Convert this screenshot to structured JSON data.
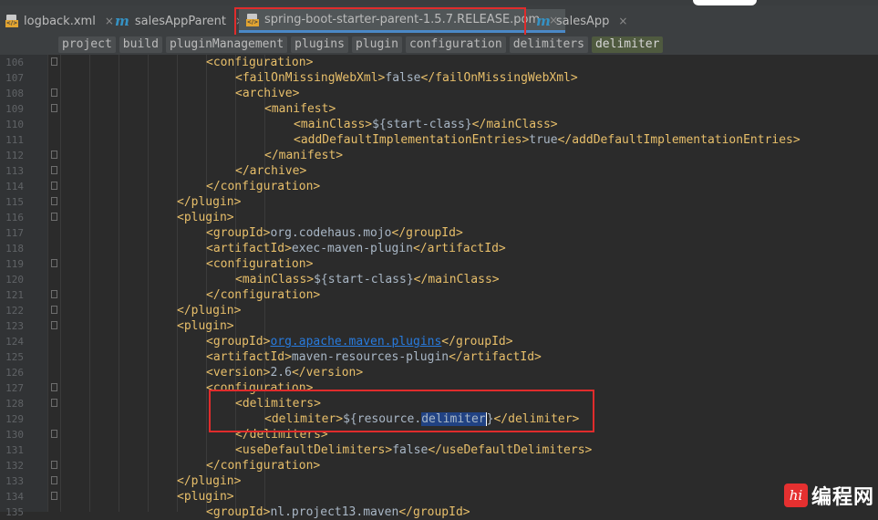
{
  "tabs": [
    {
      "label": "logback.xml",
      "icon": "xml-file-icon"
    },
    {
      "label": "salesAppParent",
      "icon": "maven-icon"
    },
    {
      "label": "spring-boot-starter-parent-1.5.7.RELEASE.pom",
      "icon": "xml-file-icon",
      "active": true
    },
    {
      "label": "salesApp",
      "icon": "maven-icon"
    }
  ],
  "close_glyph": "×",
  "breadcrumbs": [
    "project",
    "build",
    "pluginManagement",
    "plugins",
    "plugin",
    "configuration",
    "delimiters",
    "delimiter"
  ],
  "lines": [
    {
      "n": "106",
      "indent": 4,
      "parts": [
        [
          "tg",
          "<configuration>"
        ]
      ]
    },
    {
      "n": "107",
      "indent": 5,
      "parts": [
        [
          "tg",
          "<failOnMissingWebXml>"
        ],
        [
          "tx",
          "false"
        ],
        [
          "tg",
          "</failOnMissingWebXml>"
        ]
      ]
    },
    {
      "n": "108",
      "indent": 5,
      "parts": [
        [
          "tg",
          "<archive>"
        ]
      ]
    },
    {
      "n": "109",
      "indent": 6,
      "parts": [
        [
          "tg",
          "<manifest>"
        ]
      ]
    },
    {
      "n": "110",
      "indent": 7,
      "parts": [
        [
          "tg",
          "<mainClass>"
        ],
        [
          "tx",
          "${start-class}"
        ],
        [
          "tg",
          "</mainClass>"
        ]
      ]
    },
    {
      "n": "111",
      "indent": 7,
      "parts": [
        [
          "tg",
          "<addDefaultImplementationEntries>"
        ],
        [
          "tx",
          "true"
        ],
        [
          "tg",
          "</addDefaultImplementationEntries>"
        ]
      ]
    },
    {
      "n": "112",
      "indent": 6,
      "parts": [
        [
          "tg",
          "</manifest>"
        ]
      ]
    },
    {
      "n": "113",
      "indent": 5,
      "parts": [
        [
          "tg",
          "</archive>"
        ]
      ]
    },
    {
      "n": "114",
      "indent": 4,
      "parts": [
        [
          "tg",
          "</configuration>"
        ]
      ]
    },
    {
      "n": "115",
      "indent": 3,
      "parts": [
        [
          "tg",
          "</plugin>"
        ]
      ]
    },
    {
      "n": "116",
      "indent": 3,
      "parts": [
        [
          "tg",
          "<plugin>"
        ]
      ]
    },
    {
      "n": "117",
      "indent": 4,
      "parts": [
        [
          "tg",
          "<groupId>"
        ],
        [
          "tx",
          "org.codehaus.mojo"
        ],
        [
          "tg",
          "</groupId>"
        ]
      ]
    },
    {
      "n": "118",
      "indent": 4,
      "parts": [
        [
          "tg",
          "<artifactId>"
        ],
        [
          "tx",
          "exec-maven-plugin"
        ],
        [
          "tg",
          "</artifactId>"
        ]
      ]
    },
    {
      "n": "119",
      "indent": 4,
      "parts": [
        [
          "tg",
          "<configuration>"
        ]
      ]
    },
    {
      "n": "120",
      "indent": 5,
      "parts": [
        [
          "tg",
          "<mainClass>"
        ],
        [
          "tx",
          "${start-class}"
        ],
        [
          "tg",
          "</mainClass>"
        ]
      ]
    },
    {
      "n": "121",
      "indent": 4,
      "parts": [
        [
          "tg",
          "</configuration>"
        ]
      ]
    },
    {
      "n": "122",
      "indent": 3,
      "parts": [
        [
          "tg",
          "</plugin>"
        ]
      ]
    },
    {
      "n": "123",
      "indent": 3,
      "parts": [
        [
          "tg",
          "<plugin>"
        ]
      ]
    },
    {
      "n": "124",
      "indent": 4,
      "parts": [
        [
          "tg",
          "<groupId>"
        ],
        [
          "lnk",
          "org.apache.maven.plugins"
        ],
        [
          "tg",
          "</groupId>"
        ]
      ]
    },
    {
      "n": "125",
      "indent": 4,
      "parts": [
        [
          "tg",
          "<artifactId>"
        ],
        [
          "tx",
          "maven-resources-plugin"
        ],
        [
          "tg",
          "</artifactId>"
        ]
      ]
    },
    {
      "n": "126",
      "indent": 4,
      "parts": [
        [
          "tg",
          "<version>"
        ],
        [
          "tx",
          "2.6"
        ],
        [
          "tg",
          "</version>"
        ]
      ]
    },
    {
      "n": "127",
      "indent": 4,
      "parts": [
        [
          "tg",
          "<configuration>"
        ]
      ]
    },
    {
      "n": "128",
      "indent": 5,
      "parts": [
        [
          "tg",
          "<delimiters>"
        ]
      ]
    },
    {
      "n": "129",
      "indent": 6,
      "parts": [
        [
          "tg",
          "<delimiter>"
        ],
        [
          "tx",
          "${resource."
        ],
        [
          "selw",
          "delimiter"
        ],
        [
          "caret",
          ""
        ],
        [
          "tx",
          "}"
        ],
        [
          "tg",
          "</delimiter>"
        ]
      ]
    },
    {
      "n": "130",
      "indent": 5,
      "parts": [
        [
          "tg",
          "</delimiters>"
        ]
      ]
    },
    {
      "n": "131",
      "indent": 5,
      "parts": [
        [
          "tg",
          "<useDefaultDelimiters>"
        ],
        [
          "tx",
          "false"
        ],
        [
          "tg",
          "</useDefaultDelimiters>"
        ]
      ]
    },
    {
      "n": "132",
      "indent": 4,
      "parts": [
        [
          "tg",
          "</configuration>"
        ]
      ]
    },
    {
      "n": "133",
      "indent": 3,
      "parts": [
        [
          "tg",
          "</plugin>"
        ]
      ]
    },
    {
      "n": "134",
      "indent": 3,
      "parts": [
        [
          "tg",
          "<plugin>"
        ]
      ]
    },
    {
      "n": "135",
      "indent": 4,
      "parts": [
        [
          "tg",
          "<groupId>"
        ],
        [
          "tx",
          "nl.project13.maven"
        ],
        [
          "tg",
          "</groupId>"
        ]
      ]
    }
  ],
  "watermark": {
    "mark": "hi",
    "text": "编程网"
  },
  "colors": {
    "tag": "#e8bf6a",
    "text": "#a9b7c6",
    "link": "#287bde",
    "highlight": "#e02c2c",
    "selection": "#214283"
  }
}
